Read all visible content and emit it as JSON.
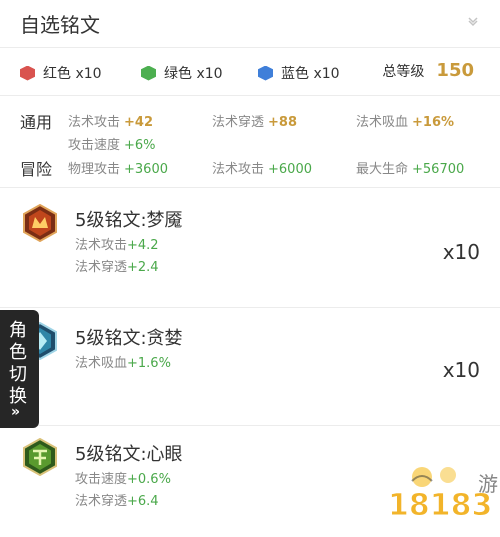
{
  "header": {
    "title": "自选铭文",
    "chevron_icon": "chevron-down-icon"
  },
  "colors": [
    {
      "icon": "red-hexagon-icon",
      "label": "红色 x10",
      "color": "#d9534f"
    },
    {
      "icon": "green-hexagon-icon",
      "label": "绿色 x10",
      "color": "#4caf50"
    },
    {
      "icon": "blue-hexagon-icon",
      "label": "蓝色 x10",
      "color": "#3f7fd9"
    }
  ],
  "total": {
    "label": "总等级",
    "value": "150"
  },
  "stats": {
    "general": {
      "label": "通用",
      "items": [
        {
          "name": "法术攻击",
          "value": "+42"
        },
        {
          "name": "法术穿透",
          "value": "+88"
        },
        {
          "name": "法术吸血",
          "value": "+16%"
        },
        {
          "name": "攻击速度",
          "value": "+6%"
        }
      ]
    },
    "adventure": {
      "label": "冒险",
      "items": [
        {
          "name": "物理攻击",
          "value": "+3600"
        },
        {
          "name": "法术攻击",
          "value": "+6000"
        },
        {
          "name": "最大生命",
          "value": "+56700"
        }
      ]
    }
  },
  "runes": [
    {
      "name": "5级铭文:梦魇",
      "icon": "nightmare-rune-icon",
      "stat1": {
        "name": "法术攻击",
        "value": "+4.2"
      },
      "stat2": {
        "name": "法术穿透",
        "value": "+2.4"
      },
      "qty": "x10"
    },
    {
      "name": "5级铭文:贪婪",
      "icon": "greed-rune-icon",
      "stat1": {
        "name": "法术吸血",
        "value": "+1.6%"
      },
      "qty": "x10"
    },
    {
      "name": "5级铭文:心眼",
      "icon": "mind-eye-rune-icon",
      "stat1": {
        "name": "攻击速度",
        "value": "+0.6%"
      },
      "stat2": {
        "name": "法术穿透",
        "value": "+6.4"
      }
    }
  ],
  "switch_tab": {
    "label": "角色切换",
    "arrow": "»"
  },
  "watermark": {
    "text": "18183",
    "sub": "游"
  }
}
